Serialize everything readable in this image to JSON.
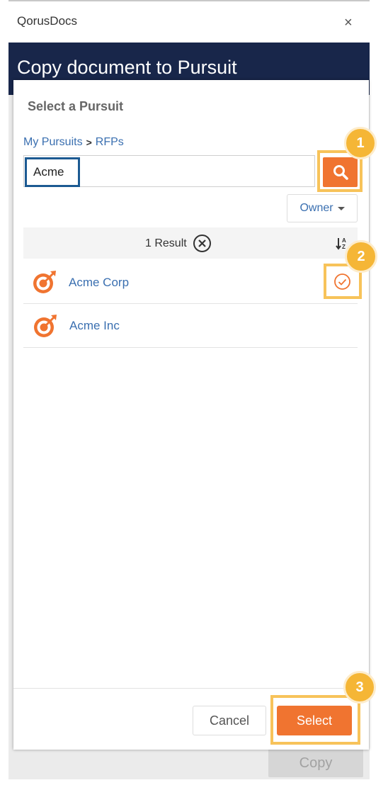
{
  "app": {
    "title": "QorusDocs",
    "close_glyph": "×"
  },
  "header": {
    "title": "Copy document to Pursuit"
  },
  "dialog": {
    "title": "Select a Pursuit",
    "breadcrumb": [
      {
        "label": "My Pursuits"
      },
      {
        "label": "RFPs"
      }
    ],
    "breadcrumb_separator": ">",
    "search": {
      "value": "Acme",
      "button_icon": "search-icon"
    },
    "owner_filter": {
      "label": "Owner"
    },
    "results": {
      "count_label": "1 Result",
      "clear_icon": "clear-circle-x-icon",
      "sort_icon": "sort-az-icon",
      "sort_glyph": "↓A​Z"
    },
    "items": [
      {
        "label": "Acme Corp",
        "icon": "pursuit-target-icon",
        "selected": true
      },
      {
        "label": "Acme Inc",
        "icon": "pursuit-target-icon",
        "selected": false
      }
    ],
    "footer": {
      "cancel_label": "Cancel",
      "select_label": "Select"
    }
  },
  "background": {
    "copy_label": "Copy"
  },
  "callouts": [
    "1",
    "2",
    "3"
  ],
  "colors": {
    "header_bg": "#18264a",
    "accent_orange": "#f07430",
    "link_blue": "#3a6fb0",
    "callout_gold": "#f5b636",
    "callout_border": "#f7c35a",
    "input_highlight": "#1c5a92"
  }
}
